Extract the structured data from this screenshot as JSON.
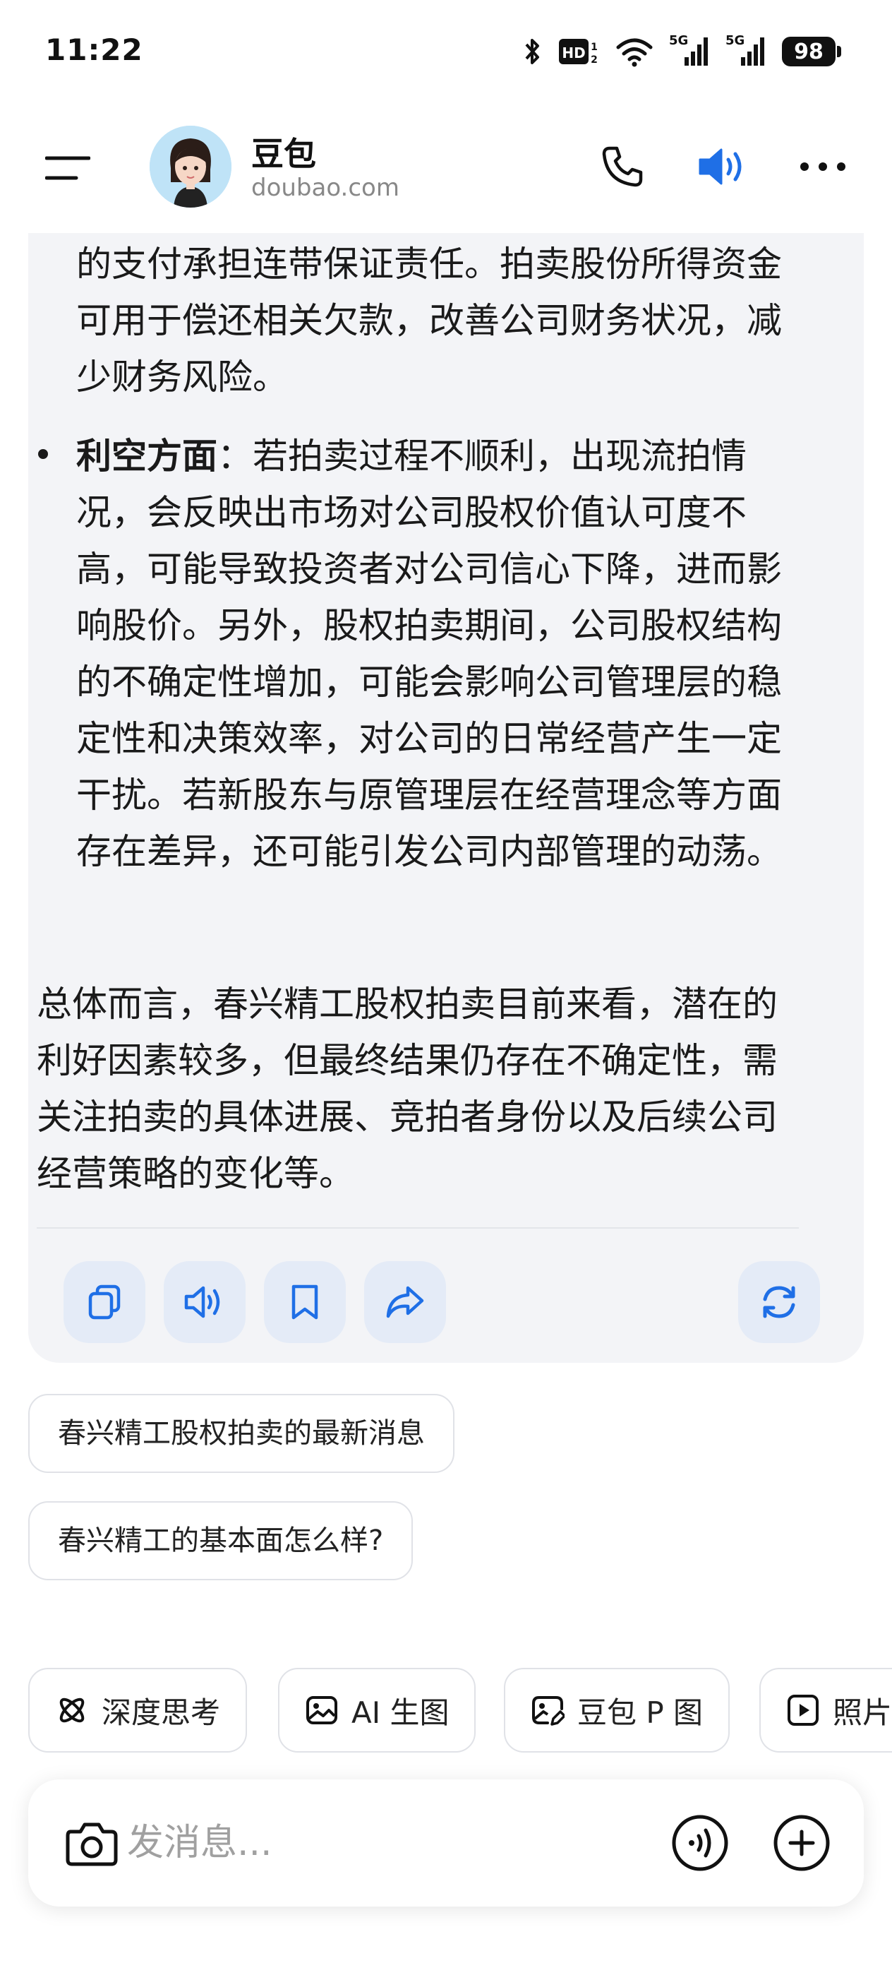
{
  "status_bar": {
    "time": "11:22",
    "network_1": "5G",
    "network_2": "5G",
    "battery": "98"
  },
  "header": {
    "title": "豆包",
    "subtitle": "doubao.com"
  },
  "message": {
    "paragraph_1": "的支付承担连带保证责任。拍卖股份所得资金可用于偿还相关欠款，改善公司财务状况，减少财务风险。",
    "bullet_label": "利空方面",
    "bullet_text": "：若拍卖过程不顺利，出现流拍情况，会反映出市场对公司股权价值认可度不高，可能导致投资者对公司信心下降，进而影响股价。另外，股权拍卖期间，公司股权结构的不确定性增加，可能会影响公司管理层的稳定性和决策效率，对公司的日常经营产生一定干扰。若新股东与原管理层在经营理念等方面存在差异，还可能引发公司内部管理的动荡。",
    "summary": "总体而言，春兴精工股权拍卖目前来看，潜在的利好因素较多，但最终结果仍存在不确定性，需关注拍卖的具体进展、竞拍者身份以及后续公司经营策略的变化等。"
  },
  "suggestions": [
    "春兴精工股权拍卖的最新消息",
    "春兴精工的基本面怎么样?"
  ],
  "tools": [
    {
      "label": "深度思考",
      "icon": "atom-icon"
    },
    {
      "label": "AI 生图",
      "icon": "image-icon"
    },
    {
      "label": "豆包 P 图",
      "icon": "image-edit-icon"
    },
    {
      "label": "照片",
      "icon": "video-icon"
    }
  ],
  "input": {
    "placeholder": "发消息..."
  },
  "colors": {
    "accent": "#1f6fe6",
    "card_bg": "#f3f4f7",
    "action_bg": "#e4ebf7"
  }
}
